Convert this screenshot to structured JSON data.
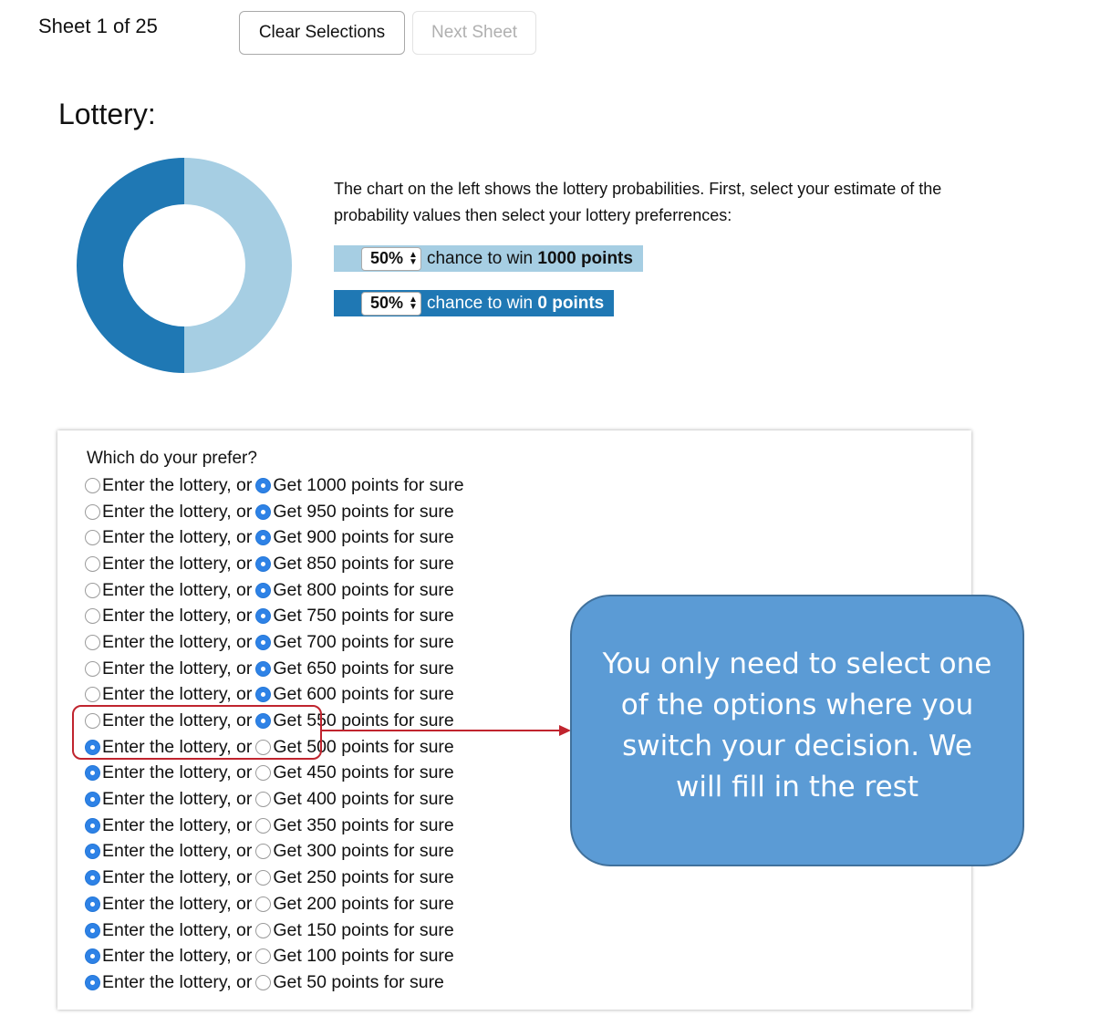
{
  "header": {
    "sheet_counter": "Sheet 1 of 25",
    "clear_button": "Clear Selections",
    "next_button": "Next Sheet"
  },
  "title": "Lottery:",
  "description": "The chart on the left shows the lottery probabilities. First, select your estimate of the probability values then select your lottery preferrences:",
  "probabilities": [
    {
      "value": "50%",
      "text": "chance to win ",
      "points": "1000 points",
      "color": "#a6cee3"
    },
    {
      "value": "50%",
      "text": "chance to win ",
      "points": "0 points",
      "color": "#1f78b4"
    }
  ],
  "chart_data": {
    "type": "pie",
    "style": "donut",
    "categories": [
      "1000 points",
      "0 points"
    ],
    "values": [
      50,
      50
    ],
    "colors": [
      "#a6cee3",
      "#1f78b4"
    ]
  },
  "question": "Which do your prefer?",
  "choices": [
    {
      "lottery": "Enter the lottery, or",
      "sure": "Get 1000 points for sure",
      "selected": "sure"
    },
    {
      "lottery": "Enter the lottery, or",
      "sure": "Get 950 points for sure",
      "selected": "sure"
    },
    {
      "lottery": "Enter the lottery, or",
      "sure": "Get 900 points for sure",
      "selected": "sure"
    },
    {
      "lottery": "Enter the lottery, or",
      "sure": "Get 850 points for sure",
      "selected": "sure"
    },
    {
      "lottery": "Enter the lottery, or",
      "sure": "Get 800 points for sure",
      "selected": "sure"
    },
    {
      "lottery": "Enter the lottery, or",
      "sure": "Get 750 points for sure",
      "selected": "sure"
    },
    {
      "lottery": "Enter the lottery, or",
      "sure": "Get 700 points for sure",
      "selected": "sure"
    },
    {
      "lottery": "Enter the lottery, or",
      "sure": "Get 650 points for sure",
      "selected": "sure"
    },
    {
      "lottery": "Enter the lottery, or",
      "sure": "Get 600 points for sure",
      "selected": "sure"
    },
    {
      "lottery": "Enter the lottery, or",
      "sure": "Get 550 points for sure",
      "selected": "sure"
    },
    {
      "lottery": "Enter the lottery, or",
      "sure": "Get 500 points for sure",
      "selected": "lottery"
    },
    {
      "lottery": "Enter the lottery, or",
      "sure": "Get 450 points for sure",
      "selected": "lottery"
    },
    {
      "lottery": "Enter the lottery, or",
      "sure": "Get 400 points for sure",
      "selected": "lottery"
    },
    {
      "lottery": "Enter the lottery, or",
      "sure": "Get 350 points for sure",
      "selected": "lottery"
    },
    {
      "lottery": "Enter the lottery, or",
      "sure": "Get 300 points for sure",
      "selected": "lottery"
    },
    {
      "lottery": "Enter the lottery, or",
      "sure": "Get 250 points for sure",
      "selected": "lottery"
    },
    {
      "lottery": "Enter the lottery, or",
      "sure": "Get 200 points for sure",
      "selected": "lottery"
    },
    {
      "lottery": "Enter the lottery, or",
      "sure": "Get 150 points for sure",
      "selected": "lottery"
    },
    {
      "lottery": "Enter the lottery, or",
      "sure": "Get 100 points for sure",
      "selected": "lottery"
    },
    {
      "lottery": "Enter the lottery, or",
      "sure": "Get 50 points for sure",
      "selected": "lottery"
    }
  ],
  "callout": "You only need to select one of the options where you switch your decision. We will fill in the rest",
  "colors": {
    "radio_selected": "#2e82e6",
    "callout_fill": "#5b9bd5",
    "highlight": "#c0242e"
  }
}
